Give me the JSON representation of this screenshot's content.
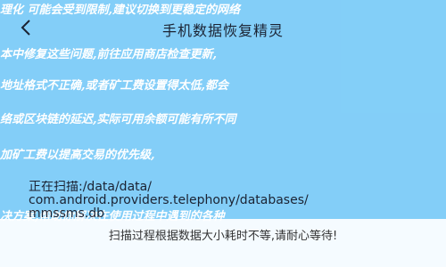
{
  "background_lines": [
    "理化 可能会受到限制,建议切换到更稳定的网络",
    "本中修复这些问题,前往应用商店检查更新,",
    "地址格式不正确,或者矿工费设置得太低,都会",
    "络或区块链的延迟,实际可用余额可能有所不同",
    "加矿工费以提高交易的优先级,",
    "决方案,帮助你解决在使用过程中遇到的各种"
  ],
  "header": {
    "title": "手机数据恢复精灵",
    "back_icon": "chevron-left-icon"
  },
  "scan": {
    "line1": "正在扫描:/data/data/",
    "line2": "com.android.providers.telephony/databases/",
    "line3": "mmssms.db"
  },
  "footer": {
    "notice": "扫描过程根据数据大小耗时不等,请耐心等待!"
  },
  "colors": {
    "background": "#1ea7f2",
    "text": "#1b2333"
  }
}
